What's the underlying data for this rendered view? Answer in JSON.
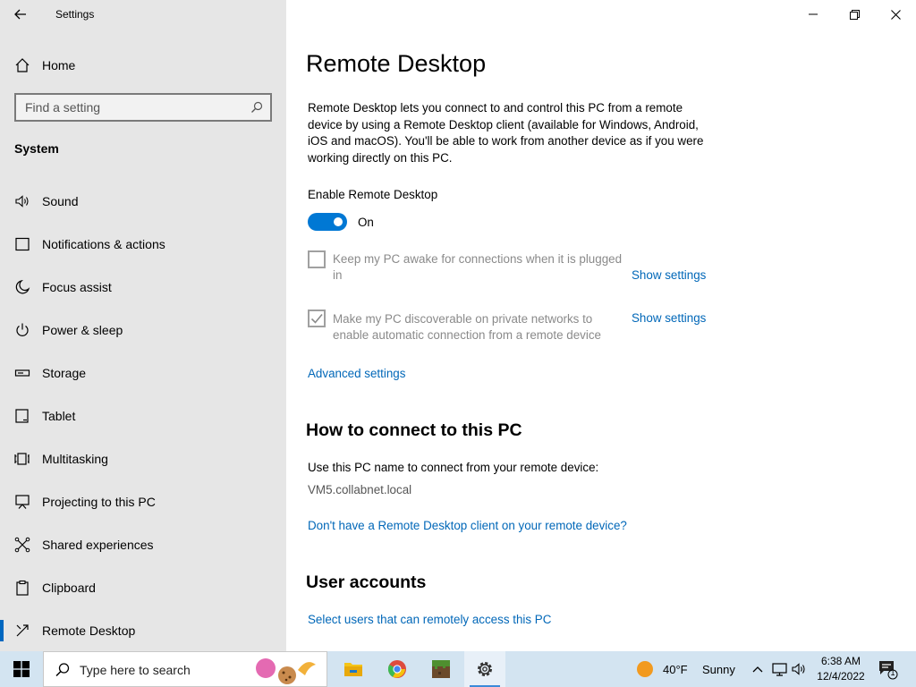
{
  "window": {
    "app_title": "Settings",
    "back_icon": "back-arrow-icon",
    "controls": [
      "minimize-icon",
      "restore-icon",
      "close-icon"
    ]
  },
  "sidebar": {
    "home_label": "Home",
    "search_placeholder": "Find a setting",
    "group_title": "System",
    "items": [
      {
        "label": "Sound",
        "icon": "speaker-icon"
      },
      {
        "label": "Notifications & actions",
        "icon": "notification-icon"
      },
      {
        "label": "Focus assist",
        "icon": "moon-icon"
      },
      {
        "label": "Power & sleep",
        "icon": "power-icon"
      },
      {
        "label": "Storage",
        "icon": "storage-icon"
      },
      {
        "label": "Tablet",
        "icon": "tablet-icon"
      },
      {
        "label": "Multitasking",
        "icon": "multitasking-icon"
      },
      {
        "label": "Projecting to this PC",
        "icon": "projector-icon"
      },
      {
        "label": "Shared experiences",
        "icon": "shared-icon"
      },
      {
        "label": "Clipboard",
        "icon": "clipboard-icon"
      },
      {
        "label": "Remote Desktop",
        "icon": "remote-desktop-icon",
        "selected": true
      }
    ]
  },
  "main": {
    "title": "Remote Desktop",
    "description": "Remote Desktop lets you connect to and control this PC from a remote device by using a Remote Desktop client (available for Windows, Android, iOS and macOS). You'll be able to work from another device as if you were working directly on this PC.",
    "enable_label": "Enable Remote Desktop",
    "toggle_state": "On",
    "option1": {
      "text": "Keep my PC awake for connections when it is plugged in",
      "checked": false,
      "link": "Show settings"
    },
    "option2": {
      "text": "Make my PC discoverable on private networks to enable automatic connection from a remote device",
      "checked": true,
      "link": "Show settings"
    },
    "advanced_link": "Advanced settings",
    "connect_heading": "How to connect to this PC",
    "connect_text": "Use this PC name to connect from your remote device:",
    "pc_name": "VM5.collabnet.local",
    "client_link": "Don't have a Remote Desktop client on your remote device?",
    "accounts_heading": "User accounts",
    "accounts_link": "Select users that can remotely access this PC"
  },
  "taskbar": {
    "search_placeholder": "Type here to search",
    "apps": [
      "file-explorer-icon",
      "chrome-icon",
      "minecraft-icon",
      "settings-icon"
    ],
    "weather_temp": "40°F",
    "weather_cond": "Sunny",
    "time": "6:38 AM",
    "date": "12/4/2022",
    "notification_count": "1",
    "accent": "#0078d4"
  }
}
